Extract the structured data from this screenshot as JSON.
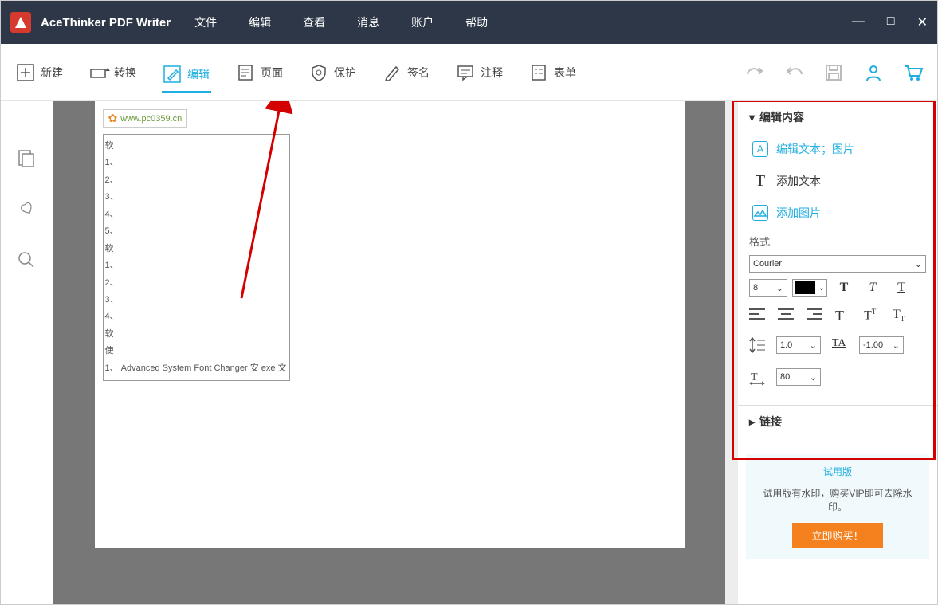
{
  "app": {
    "title": "AceThinker PDF Writer"
  },
  "menu": [
    "文件",
    "编辑",
    "查看",
    "消息",
    "账户",
    "帮助"
  ],
  "toolbar": [
    {
      "id": "new",
      "label": "新建"
    },
    {
      "id": "convert",
      "label": "转换"
    },
    {
      "id": "edit",
      "label": "编辑",
      "active": true
    },
    {
      "id": "page",
      "label": "页面"
    },
    {
      "id": "protect",
      "label": "保护"
    },
    {
      "id": "sign",
      "label": "签名"
    },
    {
      "id": "annotate",
      "label": "注释"
    },
    {
      "id": "form",
      "label": "表单"
    }
  ],
  "watermark": {
    "url": "www.pc0359.cn"
  },
  "doc_lines": [
    "软",
    "1、",
    "2、",
    "3、",
    "4、",
    "5、",
    "软",
    "1、",
    "2、",
    "3、",
    "4、",
    "软",
    "使",
    "1、 Advanced System Font Changer 安 exe 文"
  ],
  "side": {
    "section1": {
      "title": "编辑内容",
      "items": [
        {
          "label": "编辑文本；图片",
          "icon": "A",
          "active": true
        },
        {
          "label": "添加文本",
          "icon": "T"
        },
        {
          "label": "添加图片",
          "icon": "img",
          "active": true
        }
      ]
    },
    "format": {
      "label": "格式",
      "font": "Courier",
      "size": "8",
      "line_height": "1.0",
      "char_spacing": "-1.00",
      "horiz_scale": "80"
    },
    "links": {
      "title": "链接"
    }
  },
  "trial": {
    "title": "试用版",
    "msg": "试用版有水印，购买VIP即可去除水印。",
    "buy": "立即购买！"
  }
}
